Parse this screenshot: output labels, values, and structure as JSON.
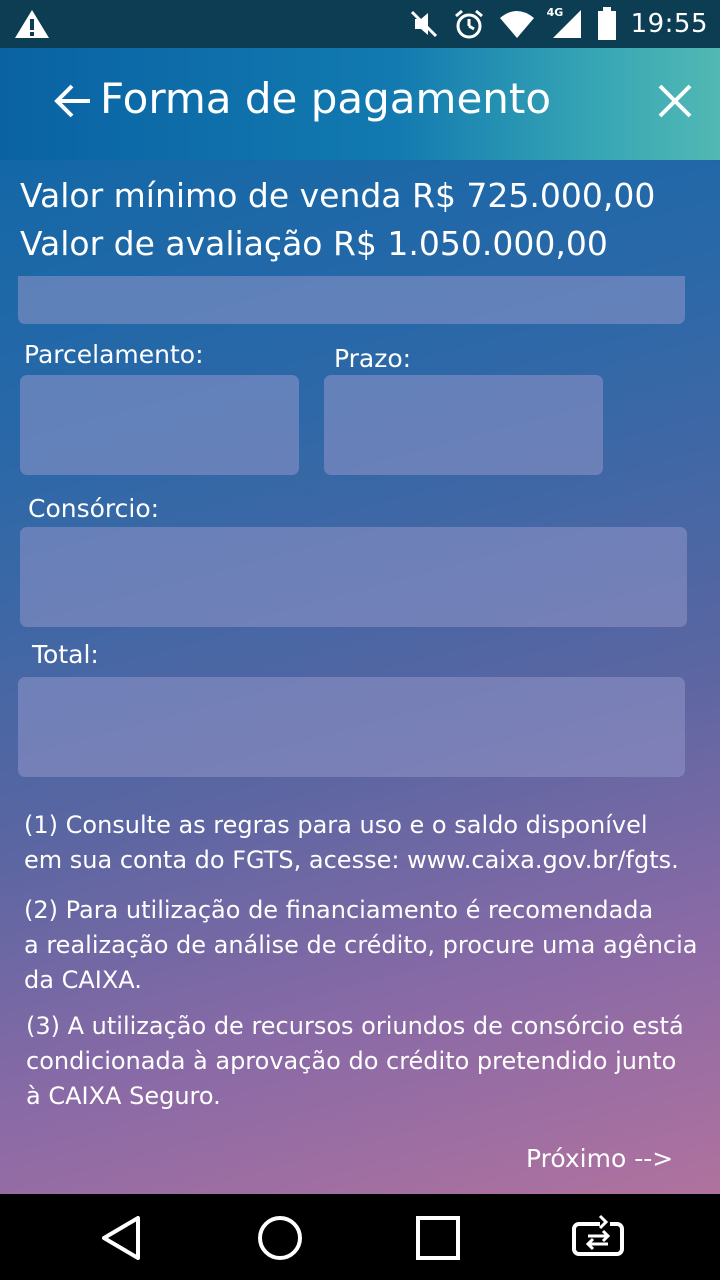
{
  "status_bar": {
    "time": "19:55",
    "network_label": "4G",
    "icons": [
      "warning-icon",
      "mute-icon",
      "alarm-icon",
      "wifi-icon",
      "signal-icon",
      "battery-icon"
    ]
  },
  "header": {
    "title": "Forma de pagamento",
    "back_icon": "arrow-left-icon",
    "close_icon": "close-icon"
  },
  "summary": {
    "min_sale": "Valor mínimo de venda R$ 725.000,00",
    "appraisal": "Valor de avaliação R$ 1.050.000,00"
  },
  "form": {
    "parcelamento_label": "Parcelamento:",
    "prazo_label": "Prazo:",
    "consorcio_label": "Consórcio:",
    "total_label": "Total:"
  },
  "notes": {
    "n1": [
      "(1) Consulte as regras para uso e o saldo disponível",
      "em sua conta do FGTS, acesse: www.caixa.gov.br/fgts."
    ],
    "n2": [
      "(2) Para utilização de financiamento é recomendada",
      "a realização de análise de crédito, procure uma agência",
      "da CAIXA."
    ],
    "n3": [
      "(3) A utilização de recursos oriundos de consórcio está",
      "condicionada à aprovação do crédito pretendido junto",
      "à CAIXA Seguro."
    ]
  },
  "next_label": "Próximo -->",
  "nav": {
    "buttons": [
      "back-triangle-icon",
      "home-circle-icon",
      "recents-square-icon",
      "rotate-screen-icon"
    ]
  },
  "colors": {
    "status_bar": "#0d3d52",
    "app_bar_start": "#0a62a3",
    "app_bar_end": "#52b8b3",
    "field": "#8f93c6"
  }
}
